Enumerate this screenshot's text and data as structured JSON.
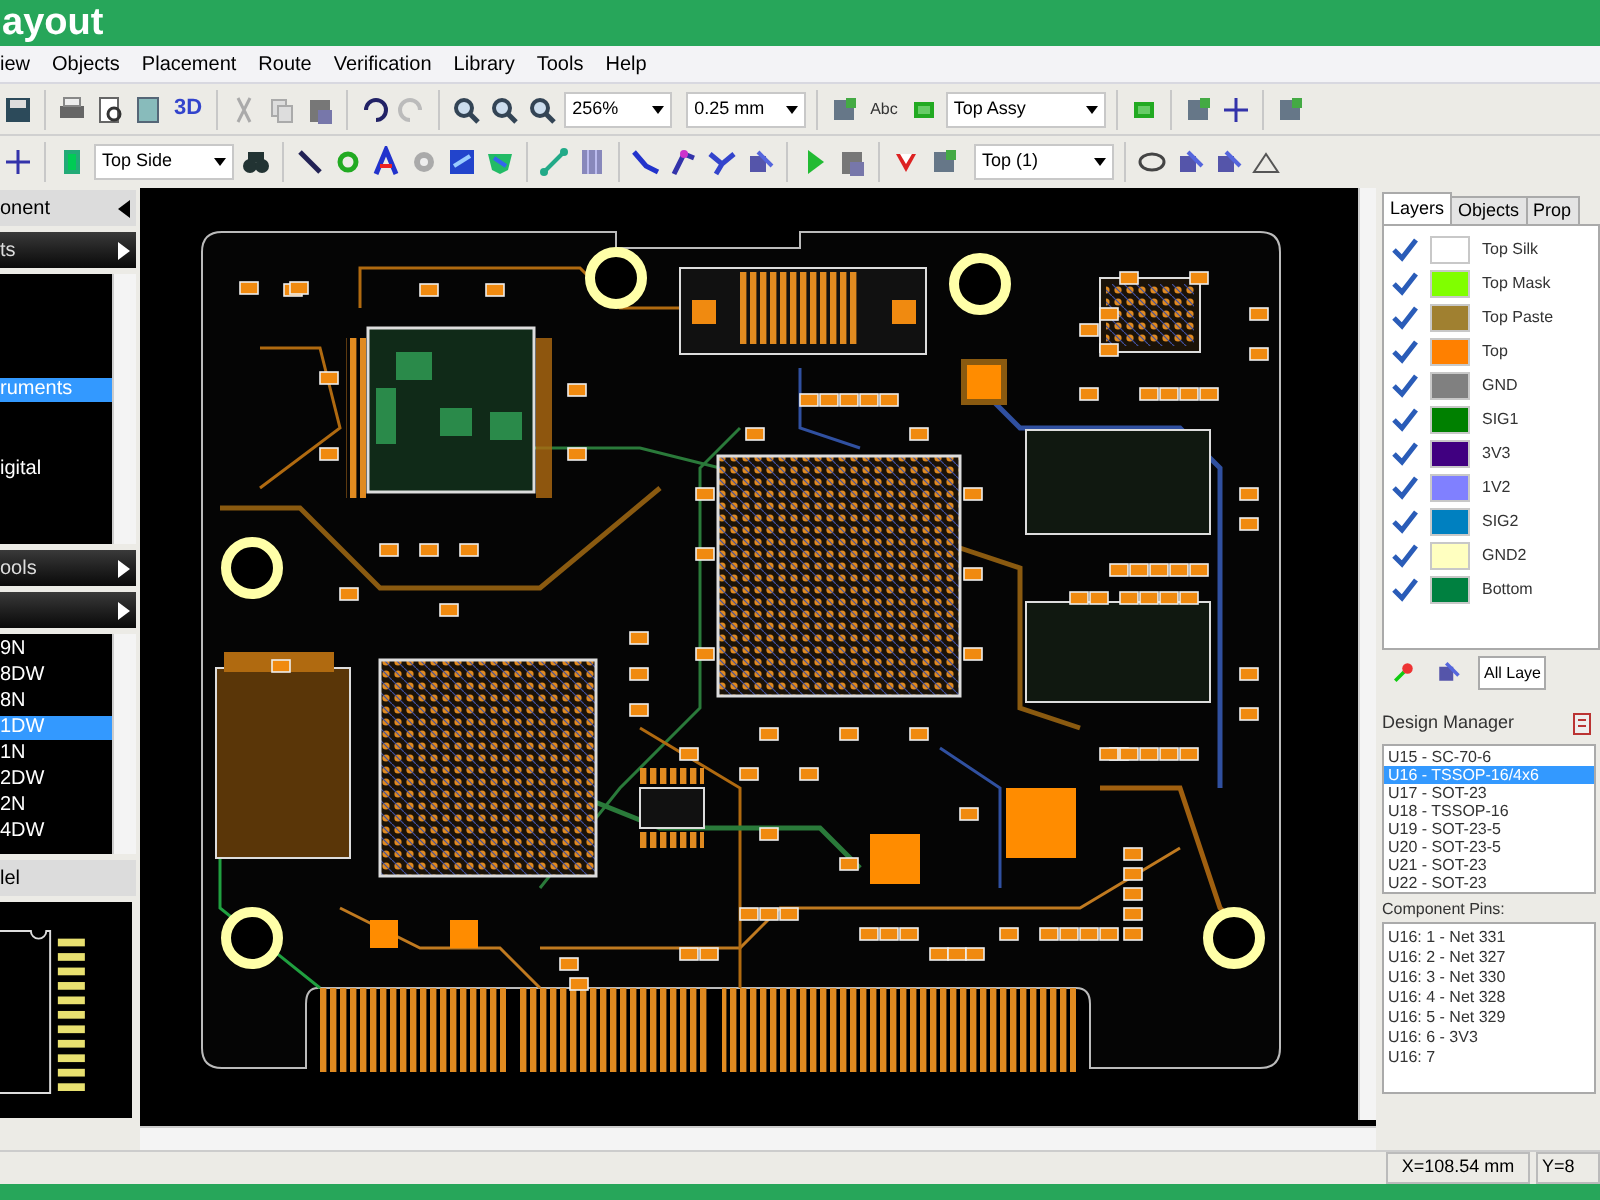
{
  "window": {
    "title": "ayout"
  },
  "menu": [
    {
      "label": "iew"
    },
    {
      "label": "Objects"
    },
    {
      "label": "Placement"
    },
    {
      "label": "Route"
    },
    {
      "label": "Verification"
    },
    {
      "label": "Library"
    },
    {
      "label": "Tools"
    },
    {
      "label": "Help"
    }
  ],
  "toolbar": {
    "view_3d": "3D",
    "zoom": "256%",
    "grid": "0.25 mm",
    "text_tool": "Abc",
    "view": "Top Assy",
    "side": "Top Side",
    "layer": "Top (1)"
  },
  "component_panel": {
    "title": "onent",
    "library_header": "ts",
    "libraries": [
      {
        "label": "ruments",
        "selected": true
      },
      {
        "label": "igital",
        "selected": false
      }
    ],
    "tools_header": "ools",
    "parts": [
      {
        "label": "9N",
        "selected": false
      },
      {
        "label": "8DW",
        "selected": false
      },
      {
        "label": "8N",
        "selected": false
      },
      {
        "label": "1DW",
        "selected": true
      },
      {
        "label": "1N",
        "selected": false
      },
      {
        "label": "2DW",
        "selected": false
      },
      {
        "label": "2N",
        "selected": false
      },
      {
        "label": "4DW",
        "selected": false
      }
    ],
    "preview_header": "lel"
  },
  "tabs": [
    {
      "label": "Layers",
      "selected": true
    },
    {
      "label": "Objects",
      "selected": false
    },
    {
      "label": "Prop",
      "selected": false
    }
  ],
  "layers": [
    {
      "name": "Top Silk",
      "color": "#ffffff",
      "checked": true
    },
    {
      "name": "Top Mask",
      "color": "#80ff00",
      "checked": true
    },
    {
      "name": "Top Paste",
      "color": "#a08030",
      "checked": true
    },
    {
      "name": "Top",
      "color": "#ff8000",
      "checked": true
    },
    {
      "name": "GND",
      "color": "#808080",
      "checked": true
    },
    {
      "name": "SIG1",
      "color": "#008000",
      "checked": true
    },
    {
      "name": "3V3",
      "color": "#400080",
      "checked": true
    },
    {
      "name": "1V2",
      "color": "#8080ff",
      "checked": true
    },
    {
      "name": "SIG2",
      "color": "#0080c0",
      "checked": true
    },
    {
      "name": "GND2",
      "color": "#ffffc0",
      "checked": true
    },
    {
      "name": "Bottom",
      "color": "#008040",
      "checked": true
    }
  ],
  "layer_filter": "All Laye",
  "design_manager": {
    "title": "Design Manager",
    "components": [
      {
        "label": "U15 - SC-70-6",
        "selected": false
      },
      {
        "label": "U16 - TSSOP-16/4x6",
        "selected": true
      },
      {
        "label": "U17 - SOT-23",
        "selected": false
      },
      {
        "label": "U18 - TSSOP-16",
        "selected": false
      },
      {
        "label": "U19 - SOT-23-5",
        "selected": false
      },
      {
        "label": "U20 - SOT-23-5",
        "selected": false
      },
      {
        "label": "U21 - SOT-23",
        "selected": false
      },
      {
        "label": "U22 - SOT-23",
        "selected": false
      }
    ],
    "pins_title": "Component Pins:",
    "pins": [
      "U16: 1 - Net 331",
      "U16: 2 - Net 327",
      "U16: 3 - Net 330",
      "U16: 4 - Net 328",
      "U16: 5 - Net 329",
      "U16: 6 - 3V3",
      "U16: 7"
    ]
  },
  "status_bar": {
    "x": "X=108.54 mm",
    "y": "Y=8"
  }
}
